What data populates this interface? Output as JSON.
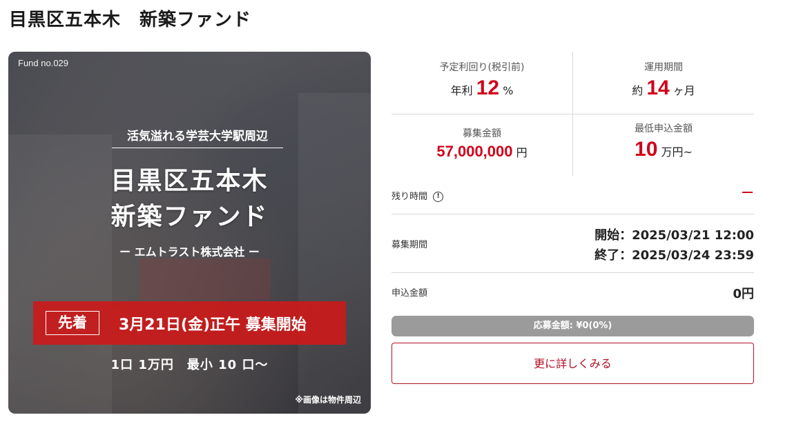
{
  "page_title": "目黒区五本木　新築ファンド",
  "hero": {
    "fund_no": "Fund no.029",
    "catch": "活気溢れる学芸大学駅周辺",
    "title_line1": "目黒区五本木",
    "title_line2": "新築ファンド",
    "company": "ー エムトラスト株式会社 ー",
    "badge": "先着",
    "banner_text": "3月21日(金)正午 募集開始",
    "unit_text": "1口 1万円　最小 10 口〜",
    "note": "※画像は物件周辺",
    "banner_color": "#cd1919"
  },
  "stats": {
    "yield": {
      "label": "予定利回り(税引前)",
      "prefix": "年利",
      "value": "12",
      "suffix": "%"
    },
    "period": {
      "label": "運用期間",
      "prefix": "約",
      "value": "14",
      "suffix": "ヶ月"
    },
    "amount": {
      "label": "募集金額",
      "value": "57,000,000",
      "suffix": "円"
    },
    "minimum": {
      "label": "最低申込金額",
      "value": "10",
      "suffix": "万円~"
    },
    "accent_color": "#d0021b"
  },
  "remaining": {
    "label": "残り時間",
    "icon": "info-icon",
    "value": "—"
  },
  "recruit_period": {
    "label": "募集期間",
    "start": "開始：2025/03/21 12:00",
    "end": "終了：2025/03/24 23:59"
  },
  "applied": {
    "label": "申込金額",
    "value": "0円"
  },
  "progress": {
    "text": "応募金額: ¥0(0%)",
    "percent": 0
  },
  "more_button": {
    "label": "更に詳しくみる",
    "color": "#b01025"
  }
}
